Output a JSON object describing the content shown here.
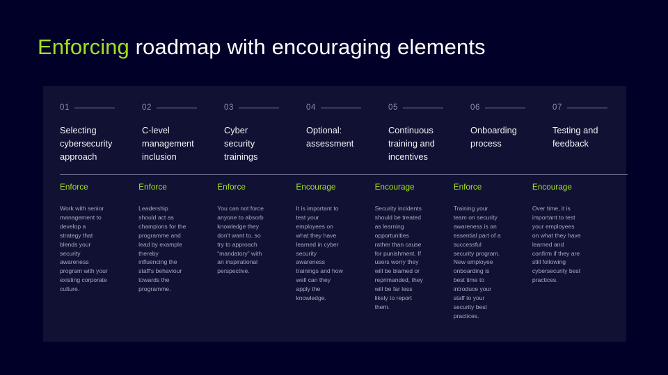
{
  "title": {
    "accent_word": "Enforcing",
    "rest": " roadmap with encouraging elements"
  },
  "colors": {
    "background": "#010029",
    "panel": "#111233",
    "accent_green": "#a3e022",
    "heading_text": "#f2f3f8",
    "body_text": "#a6a8c0",
    "number_text": "#8b8da8",
    "divider": "#6e7090"
  },
  "columns": [
    {
      "number": "01",
      "heading": "Selecting cybersecurity approach",
      "tag": "Enforce",
      "body": "Work with senior management to develop a strategy that blends your security awareness program with your existing corporate culture."
    },
    {
      "number": "02",
      "heading": "C-level management inclusion",
      "tag": "Enforce",
      "body": "Leadership should act as champions for the programme and lead by example thereby influencing the staff's behaviour towards the programme."
    },
    {
      "number": "03",
      "heading": "Cyber security trainings",
      "tag": "Enforce",
      "body": "You can not force anyone to absorb knowledge they don't want to, so try to approach “mandatory” with an inspirational perspective."
    },
    {
      "number": "04",
      "heading": "Optional: assessment",
      "tag": "Encourage",
      "body": "It is important to test your employees on what they have learned in cyber security awareness trainings and how well can they apply the knowledge."
    },
    {
      "number": "05",
      "heading": "Continuous training and incentives",
      "tag": "Encourage",
      "body": "Security incidents should be treated as learning opportunities rather than cause for punishment. If users worry they will be blamed or reprimanded, they will be far less likely to report them."
    },
    {
      "number": "06",
      "heading": "Onboarding process",
      "tag": "Enforce",
      "body": "Training your team on security awareness is an essential part of a successful security program. New employee onboarding is best time to introduce your staff to your security best practices."
    },
    {
      "number": "07",
      "heading": "Testing and feedback",
      "tag": "Encourage",
      "body": "Over time, it is important to test your employees on what they have learned and confirm if they are still following cybersecurity best practices."
    }
  ]
}
